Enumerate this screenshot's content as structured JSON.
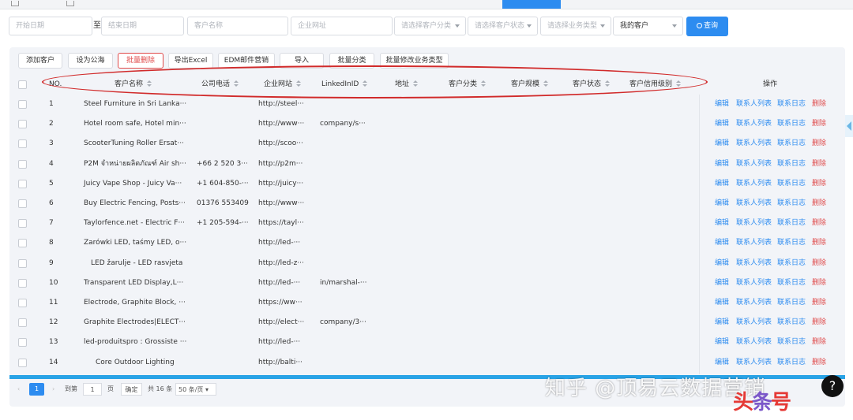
{
  "filters": {
    "start_date": "开始日期",
    "to": "至",
    "end_date": "结束日期",
    "customer_name": "客户名称",
    "website": "企业网址",
    "category": "请选择客户分类",
    "status": "请选择客户状态",
    "biz_type": "请选择业务类型",
    "scope": "我的客户",
    "query": "查询"
  },
  "toolbar": [
    "添加客户",
    "设为公海",
    "批量删除",
    "导出Excel",
    "EDM邮件营销",
    "导入",
    "批量分类",
    "批量修改业务类型"
  ],
  "columns": {
    "no": "NO.",
    "name": "客户名称",
    "phone": "公司电话",
    "website": "企业网站",
    "linkedin": "LinkedInID",
    "address": "地址",
    "category": "客户分类",
    "scale": "客户规模",
    "status": "客户状态",
    "credit": "客户信用级别",
    "actions": "操作"
  },
  "actions": {
    "edit": "编辑",
    "contacts": "联系人列表",
    "log": "联系日志",
    "delete": "删除"
  },
  "rows": [
    {
      "no": "1",
      "name": "Steel Furniture in Sri Lanka···",
      "phone": "",
      "website": "http://steel···",
      "linkedin": ""
    },
    {
      "no": "2",
      "name": "Hotel room safe, Hotel min···",
      "phone": "",
      "website": "http://www···",
      "linkedin": "company/s···"
    },
    {
      "no": "3",
      "name": "ScooterTuning Roller Ersat···",
      "phone": "",
      "website": "http://scoo···",
      "linkedin": ""
    },
    {
      "no": "4",
      "name": "P2M จำหน่ายผลิตภัณฑ์ Air sh···",
      "phone": "+66 2 520 3···",
      "website": "http://p2m···",
      "linkedin": ""
    },
    {
      "no": "5",
      "name": "Juicy Vape Shop - Juicy Va···",
      "phone": "+1 604-850-···",
      "website": "http://juicy···",
      "linkedin": ""
    },
    {
      "no": "6",
      "name": "Buy Electric Fencing, Posts···",
      "phone": "01376 553409",
      "website": "http://www···",
      "linkedin": ""
    },
    {
      "no": "7",
      "name": "Taylorfence.net - Electric F···",
      "phone": "+1 205-594-···",
      "website": "https://tayl···",
      "linkedin": ""
    },
    {
      "no": "8",
      "name": "Zarówki LED, taśmy LED, o···",
      "phone": "",
      "website": "http://led-···",
      "linkedin": ""
    },
    {
      "no": "9",
      "name": "LED žarulje - LED rasvjeta",
      "phone": "",
      "website": "http://led-z···",
      "linkedin": ""
    },
    {
      "no": "10",
      "name": "Transparent LED Display,L···",
      "phone": "",
      "website": "http://led-···",
      "linkedin": "in/marshal-···"
    },
    {
      "no": "11",
      "name": "Electrode, Graphite Block, ···",
      "phone": "",
      "website": "https://ww···",
      "linkedin": ""
    },
    {
      "no": "12",
      "name": "Graphite Electrodes|ELECT···",
      "phone": "",
      "website": "http://elect···",
      "linkedin": "company/3···"
    },
    {
      "no": "13",
      "name": "led-produitspro : Grossiste ···",
      "phone": "",
      "website": "http://led-···",
      "linkedin": ""
    },
    {
      "no": "14",
      "name": "Core Outdoor Lighting",
      "phone": "",
      "website": "http://balti···",
      "linkedin": ""
    }
  ],
  "pagination": {
    "current": "1",
    "goto": "到第",
    "page_input": "1",
    "page_unit": "页",
    "confirm": "确定",
    "total": "共 16 条",
    "page_size": "50 条/页"
  },
  "watermark": "知乎 @顶易云数据营销",
  "logo": "头条号",
  "help": "?",
  "colors": {
    "primary": "#2d8cf0",
    "danger": "#e04a4a",
    "highlight_ring": "#d12a2a"
  }
}
